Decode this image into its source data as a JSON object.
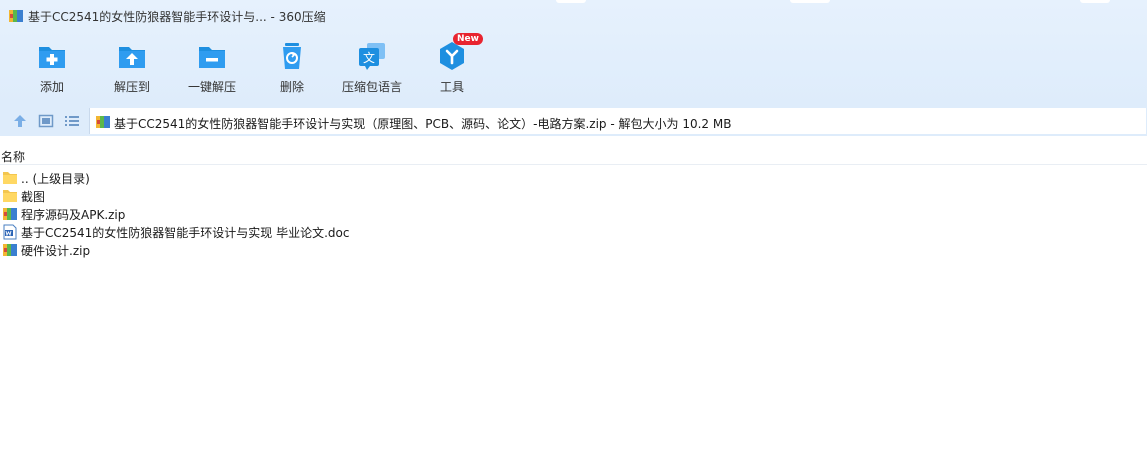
{
  "window": {
    "title": "基于CC2541的女性防狼器智能手环设计与... - 360压缩"
  },
  "toolbar": {
    "items": [
      {
        "label": "添加",
        "icon": "add-icon"
      },
      {
        "label": "解压到",
        "icon": "extract-to-icon"
      },
      {
        "label": "一键解压",
        "icon": "one-click-extract-icon"
      },
      {
        "label": "删除",
        "icon": "delete-icon"
      },
      {
        "label": "压缩包语言",
        "icon": "archive-language-icon"
      },
      {
        "label": "工具",
        "icon": "tools-icon",
        "badge": "New"
      }
    ]
  },
  "address": {
    "path": "基于CC2541的女性防狼器智能手环设计与实现（原理图、PCB、源码、论文）-电路方案.zip - 解包大小为 10.2 MB"
  },
  "filelist": {
    "column_name": "名称",
    "items": [
      {
        "name": ".. (上级目录)",
        "icon": "folder-icon"
      },
      {
        "name": "截图",
        "icon": "folder-icon"
      },
      {
        "name": "程序源码及APK.zip",
        "icon": "zip-archive-icon"
      },
      {
        "name": "基于CC2541的女性防狼器智能手环设计与实现 毕业论文.doc",
        "icon": "word-document-icon"
      },
      {
        "name": "硬件设计.zip",
        "icon": "zip-archive-icon"
      }
    ]
  },
  "colors": {
    "toolbar_bg": "#deecfb",
    "icon_blue": "#1e8fe0",
    "badge_red": "#e8242f"
  }
}
